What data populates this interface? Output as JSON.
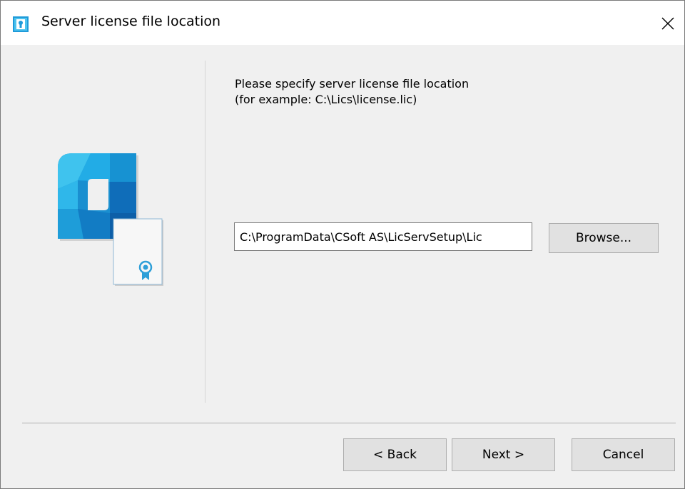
{
  "window": {
    "title": "Server license file location",
    "close_glyph": "✕"
  },
  "icons": {
    "app": "license-server-icon",
    "logo": "license-certificate-logo",
    "close": "close-icon"
  },
  "colors": {
    "logo_primary": "#1a8fd0",
    "logo_light": "#3fc3ee",
    "logo_dark": "#0d5fa8",
    "ribbon": "#2e9fd8"
  },
  "instruction": {
    "line1": "Please specify server license file location",
    "line2": "(for example: C:\\Lics\\license.lic)"
  },
  "path_field": {
    "value": "C:\\ProgramData\\CSoft AS\\LicServSetup\\Lic"
  },
  "buttons": {
    "browse": "Browse...",
    "back": "< Back",
    "next": "Next >",
    "cancel": "Cancel"
  }
}
